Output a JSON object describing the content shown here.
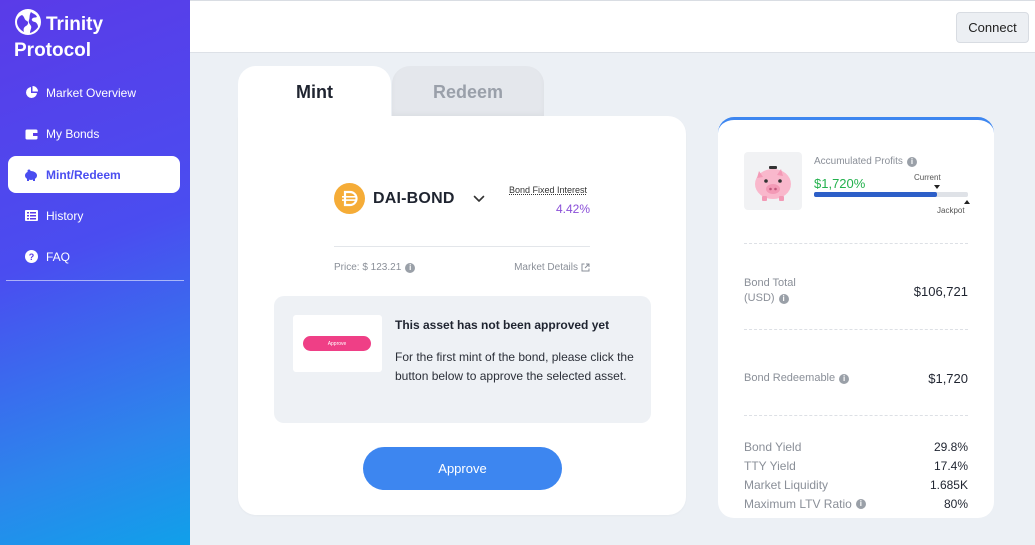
{
  "brand": {
    "name": "Trinity Protocol"
  },
  "sidebar": {
    "items": [
      {
        "label": "Market Overview",
        "icon": "pie-chart-icon",
        "active": false
      },
      {
        "label": "My Bonds",
        "icon": "wallet-icon",
        "active": false
      },
      {
        "label": "Mint/Redeem",
        "icon": "piggy-bank-icon",
        "active": true
      },
      {
        "label": "History",
        "icon": "history-icon",
        "active": false
      },
      {
        "label": "FAQ",
        "icon": "question-icon",
        "active": false
      }
    ]
  },
  "header": {
    "connect_label": "Connect"
  },
  "tabs": {
    "mint": "Mint",
    "redeem": "Redeem"
  },
  "mint": {
    "token_name": "DAI-BOND",
    "fixed_interest_label": "Bond Fixed Interest",
    "fixed_interest_value": "4.42%",
    "price_text": "Price: $ 123.21",
    "market_details_label": "Market Details",
    "notice": {
      "image_button_label": "Approve",
      "title": "This asset has not been approved yet",
      "body": "For the first mint of the bond, please click the button below to approve the selected asset."
    },
    "approve_label": "Approve"
  },
  "stats": {
    "accumulated_label": "Accumulated Profits",
    "accumulated_value": "$1,720%",
    "current_label": "Current",
    "jackpot_label": "Jackpot",
    "progress": 0.8,
    "bond_total_label_1": "Bond Total",
    "bond_total_label_2": "(USD)",
    "bond_total_value": "$106,721",
    "redeemable_label": "Bond Redeemable",
    "redeemable_value": "$1,720",
    "metrics": [
      {
        "label": "Bond Yield",
        "value": "29.8%",
        "info": false
      },
      {
        "label": "TTY Yield",
        "value": "17.4%",
        "info": false
      },
      {
        "label": "Market Liquidity",
        "value": "1.685K",
        "info": false
      },
      {
        "label": "Maximum LTV Ratio",
        "value": "80%",
        "info": true
      }
    ]
  },
  "colors": {
    "accent": "#3d86f0",
    "profit": "#23b14d",
    "interest": "#8a4fd8",
    "approve_pink": "#ef3f86"
  }
}
